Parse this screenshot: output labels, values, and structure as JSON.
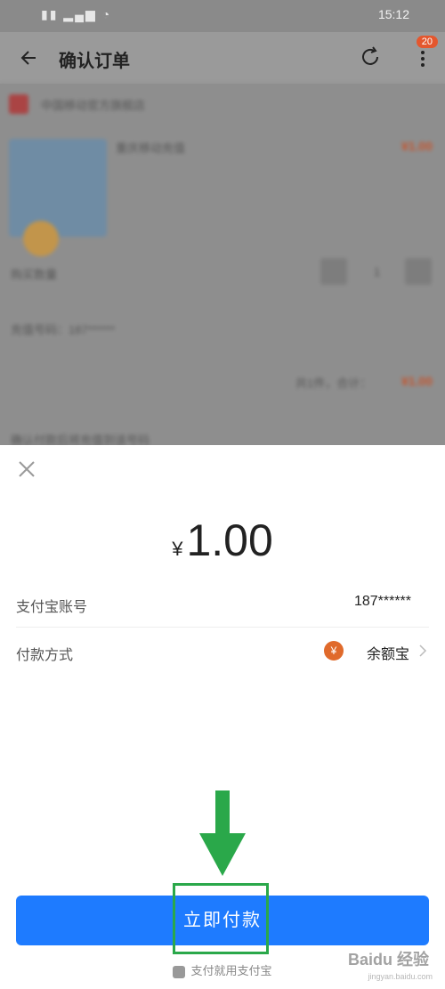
{
  "statusbar": {
    "left": "",
    "right": "15:12"
  },
  "header": {
    "title": "确认订单",
    "badge": "20"
  },
  "order": {
    "shop_name": "中国移动官方旗舰店",
    "product_title": "重庆移动充值",
    "price": "¥1.00",
    "quantity_label": "购买数量",
    "quantity": "1",
    "delivery": "充值号码：187******",
    "subtotal_label": "共1件，合计：",
    "subtotal": "¥1.00",
    "note": "确认付款后将充值到该号码"
  },
  "payment": {
    "currency": "¥",
    "amount": "1.00",
    "account_label": "支付宝账号",
    "account_value": "187******",
    "method_label": "付款方式",
    "method_value": "余额宝",
    "pay_button": "立即付款",
    "footer": "支付就用支付宝"
  },
  "watermark": {
    "text": "Baidu 经验",
    "sub": "jingyan.baidu.com"
  },
  "colors": {
    "primary": "#1e7bff",
    "highlight": "#2aa84a",
    "orange": "#e06a2b"
  }
}
